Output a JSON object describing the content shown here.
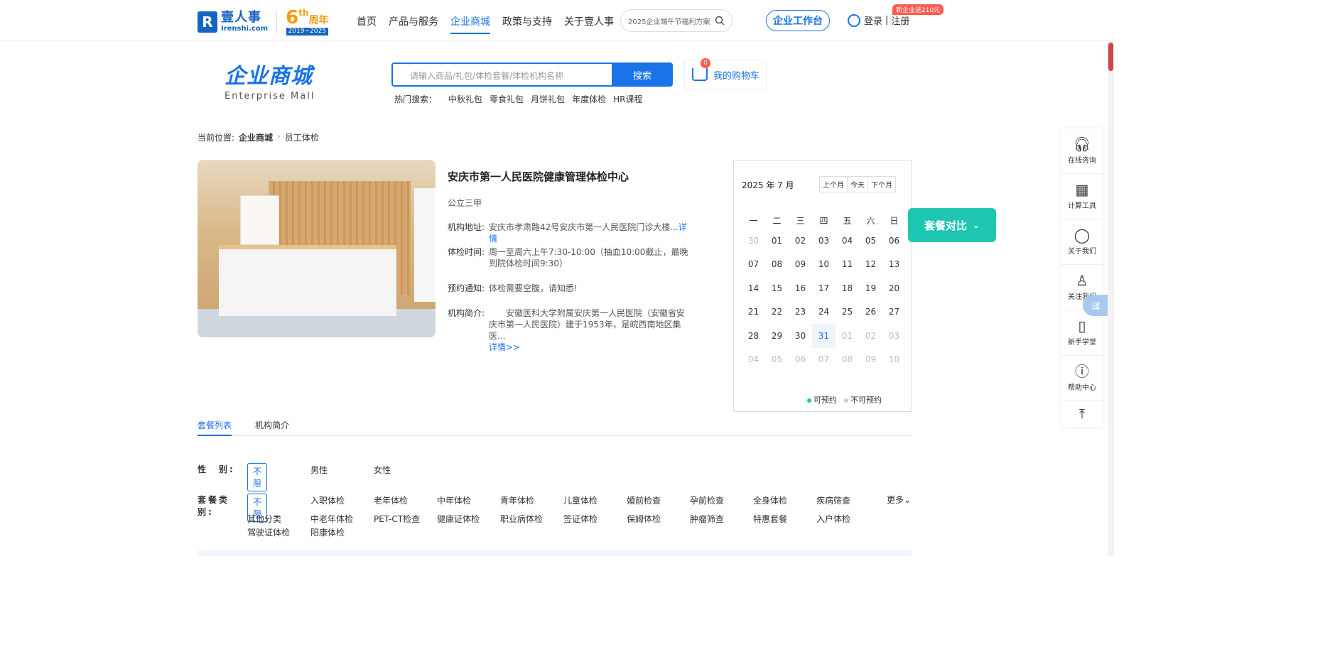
{
  "header": {
    "logo_cn": "壹人事",
    "logo_en": "Irenshi.com",
    "anniv_num": "6",
    "anniv_th": "th",
    "anniv_word": "周年",
    "anniv_years": "2019~2025",
    "nav": [
      "首页",
      "产品与服务",
      "企业商城",
      "政策与支持",
      "关于壹人事"
    ],
    "active_nav": "企业商城",
    "search_text": "2025企业端午节福利方案",
    "workbench": "企业工作台",
    "login": "登录",
    "register": "注册",
    "promo": "新企业送210元"
  },
  "mall": {
    "title_cn": "企业商城",
    "title_en": "Enterprise Mall",
    "search_placeholder": "请输入商品/礼包/体检套餐/体检机构名称",
    "search_btn": "搜索",
    "hot_label": "热门搜索：",
    "hot": [
      "中秋礼包",
      "零食礼包",
      "月饼礼包",
      "年度体检",
      "HR课程"
    ],
    "cart_label": "我的购物车",
    "cart_count": "0"
  },
  "breadcrumb": {
    "prefix": "当前位置:",
    "level1": "企业商城",
    "level2": "员工体检"
  },
  "institution": {
    "name": "安庆市第一人民医院健康管理体检中心",
    "level": "公立三甲",
    "addr_label": "机构地址:",
    "addr": "安庆市孝肃路42号安庆市第一人民医院门诊大楼...",
    "addr_more": "详情",
    "time_label": "体检时间:",
    "time": "周一至周六上午7:30-10:00（抽血10:00截止，最晚到院体检时间9:30）",
    "notice_label": "预约通知:",
    "notice": "体检需要空腹，请知悉!",
    "intro_label": "机构简介:",
    "intro": "安徽医科大学附属安庆第一人民医院（安徽省安庆市第一人民医院）建于1953年，是皖西南地区集医...",
    "intro_more": "详情>>"
  },
  "calendar": {
    "title": "2025 年 7 月",
    "btn_prev": "上个月",
    "btn_today": "今天",
    "btn_next": "下个月",
    "weekdays": [
      "一",
      "二",
      "三",
      "四",
      "五",
      "六",
      "日"
    ],
    "weeks": [
      [
        "30",
        "01",
        "02",
        "03",
        "04",
        "05",
        "06"
      ],
      [
        "07",
        "08",
        "09",
        "10",
        "11",
        "12",
        "13"
      ],
      [
        "14",
        "15",
        "16",
        "17",
        "18",
        "19",
        "20"
      ],
      [
        "21",
        "22",
        "23",
        "24",
        "25",
        "26",
        "27"
      ],
      [
        "28",
        "29",
        "30",
        "31",
        "01",
        "02",
        "03"
      ],
      [
        "04",
        "05",
        "06",
        "07",
        "08",
        "09",
        "10"
      ]
    ],
    "muted_cells": [
      "0-0",
      "4-4",
      "4-5",
      "4-6",
      "5-0",
      "5-1",
      "5-2",
      "5-3",
      "5-4",
      "5-5",
      "5-6"
    ],
    "today_cell": "4-3",
    "legend_available": "可预约",
    "legend_unavailable": "不可预约",
    "available_color": "#1fc6b2",
    "unavailable_color": "#cccccc"
  },
  "compare_btn": "套餐对比",
  "sidebar": [
    {
      "label": "在线咨询",
      "icon": "headset-icon"
    },
    {
      "label": "计算工具",
      "icon": "calculator-icon"
    },
    {
      "label": "关于我们",
      "icon": "user-icon"
    },
    {
      "label": "关注我们",
      "icon": "add-user-icon"
    },
    {
      "label": "新手学堂",
      "icon": "book-icon"
    },
    {
      "label": "帮助中心",
      "icon": "help-icon"
    }
  ],
  "translate_label": "译",
  "tabs": [
    "套餐列表",
    "机构简介"
  ],
  "filters": {
    "gender_label": "性　别:",
    "gender_options": [
      "不限",
      "男性",
      "女性"
    ],
    "type_label": "套餐类别:",
    "type_options": [
      "不限",
      "入职体检",
      "老年体检",
      "中年体检",
      "青年体检",
      "儿童体检",
      "婚前检查",
      "孕前检查",
      "全身体检",
      "疾病筛查",
      "其他分类",
      "中老年体检",
      "PET-CT检查",
      "健康证体检",
      "职业病体检",
      "签证体检",
      "保姆体检",
      "肿瘤筛查",
      "特惠套餐",
      "入户体检",
      "驾驶证体检",
      "阳康体检"
    ],
    "more": "更多"
  },
  "brand_color": "#1a73e8"
}
